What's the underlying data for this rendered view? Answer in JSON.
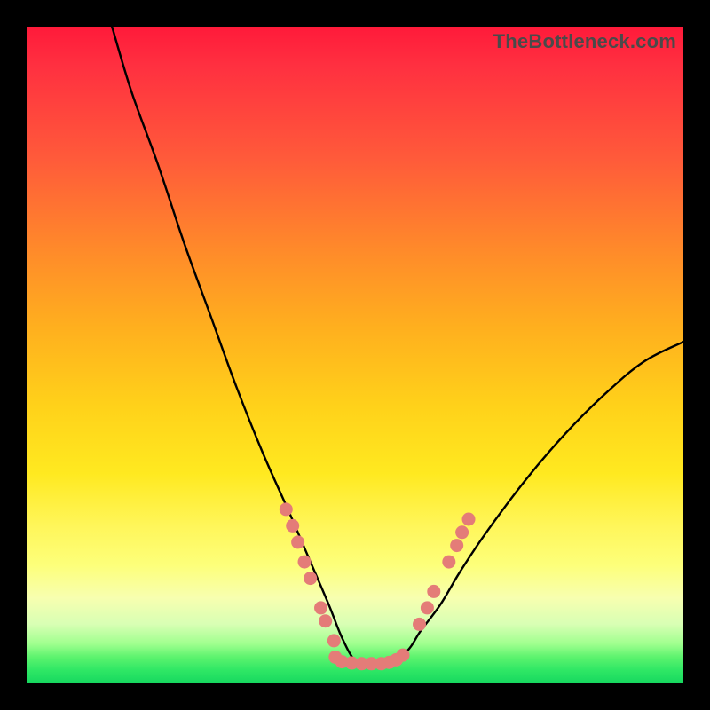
{
  "watermark": "TheBottleneck.com",
  "colors": {
    "curve_stroke": "#000000",
    "dot_fill": "#e47c78",
    "dot_stroke": "#e47c78",
    "frame_bg": "#000000"
  },
  "chart_data": {
    "type": "line",
    "title": "",
    "xlabel": "",
    "ylabel": "",
    "xlim": [
      0,
      100
    ],
    "ylim": [
      0,
      100
    ],
    "note": "Axes are unlabeled percentage-like coordinates (0–100). y grows upward. The V-shaped curve bottoms near x≈48–55 at y≈3 and rises to y≈100 at x≈13 (left) and y≈52 at x≈100 (right).",
    "series": [
      {
        "name": "v-curve",
        "x": [
          13,
          16,
          20,
          24,
          28,
          32,
          36,
          40,
          43,
          46,
          48,
          50,
          52,
          55,
          58,
          60,
          63,
          66,
          70,
          76,
          82,
          88,
          94,
          100
        ],
        "y": [
          100,
          90,
          79,
          67,
          56,
          45,
          35,
          26,
          19,
          12,
          7,
          3.5,
          3,
          3,
          5,
          8,
          12,
          17,
          23,
          31,
          38,
          44,
          49,
          52
        ]
      }
    ],
    "dots": {
      "name": "markers",
      "note": "Salmon dots along the lower arms of the V and across the trough.",
      "points": [
        {
          "x": 39.5,
          "y": 26.5
        },
        {
          "x": 40.5,
          "y": 24.0
        },
        {
          "x": 41.3,
          "y": 21.5
        },
        {
          "x": 42.3,
          "y": 18.5
        },
        {
          "x": 43.2,
          "y": 16.0
        },
        {
          "x": 44.8,
          "y": 11.5
        },
        {
          "x": 45.5,
          "y": 9.5
        },
        {
          "x": 46.8,
          "y": 6.5
        },
        {
          "x": 47.0,
          "y": 4.0
        },
        {
          "x": 48.0,
          "y": 3.3
        },
        {
          "x": 49.5,
          "y": 3.1
        },
        {
          "x": 51.0,
          "y": 3.0
        },
        {
          "x": 52.5,
          "y": 3.0
        },
        {
          "x": 54.0,
          "y": 3.0
        },
        {
          "x": 55.2,
          "y": 3.2
        },
        {
          "x": 56.3,
          "y": 3.6
        },
        {
          "x": 57.3,
          "y": 4.3
        },
        {
          "x": 59.8,
          "y": 9.0
        },
        {
          "x": 61.0,
          "y": 11.5
        },
        {
          "x": 62.0,
          "y": 14.0
        },
        {
          "x": 64.3,
          "y": 18.5
        },
        {
          "x": 65.5,
          "y": 21.0
        },
        {
          "x": 66.3,
          "y": 23.0
        },
        {
          "x": 67.3,
          "y": 25.0
        }
      ]
    }
  }
}
